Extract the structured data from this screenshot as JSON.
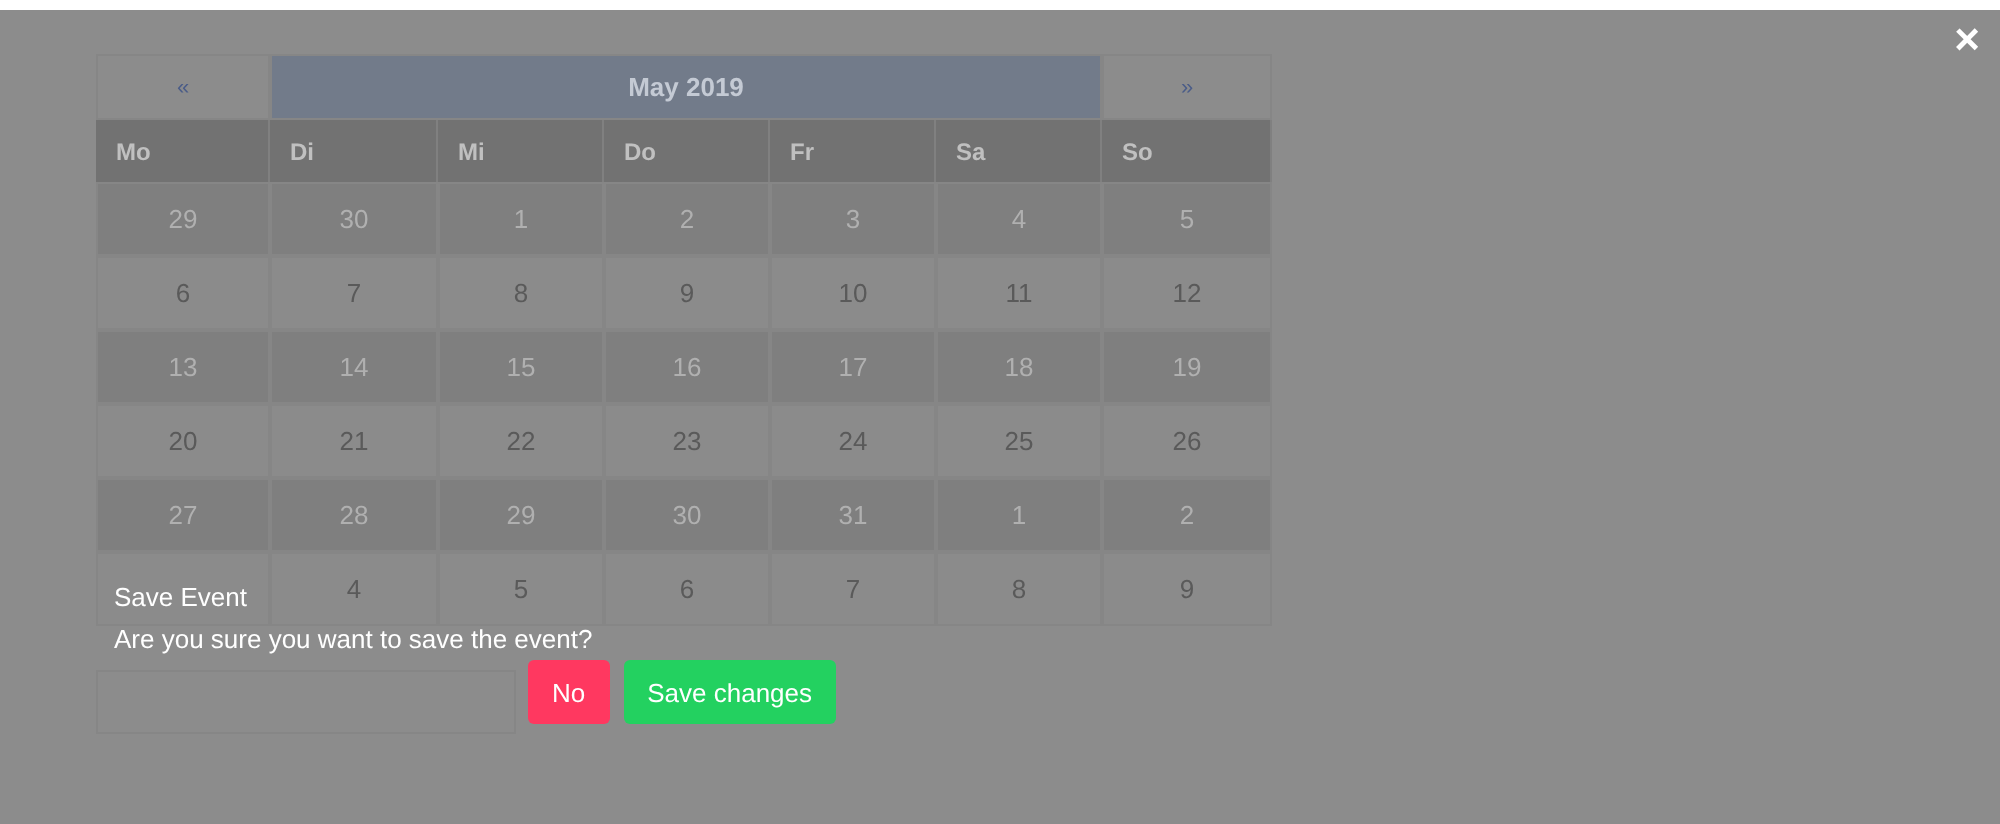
{
  "calendar": {
    "prev": "«",
    "title": "May 2019",
    "next": "»",
    "weekdays": [
      "Mo",
      "Di",
      "Mi",
      "Do",
      "Fr",
      "Sa",
      "So"
    ],
    "weeks": [
      [
        "29",
        "30",
        "1",
        "2",
        "3",
        "4",
        "5"
      ],
      [
        "6",
        "7",
        "8",
        "9",
        "10",
        "11",
        "12"
      ],
      [
        "13",
        "14",
        "15",
        "16",
        "17",
        "18",
        "19"
      ],
      [
        "20",
        "21",
        "22",
        "23",
        "24",
        "25",
        "26"
      ],
      [
        "27",
        "28",
        "29",
        "30",
        "31",
        "1",
        "2"
      ],
      [
        "4",
        "5",
        "6",
        "7",
        "8",
        "9"
      ]
    ]
  },
  "dialog": {
    "title": "Save Event",
    "message": "Are you sure you want to save the event?",
    "buttons": [
      {
        "label": "No",
        "kind": "danger"
      },
      {
        "label": "Save changes",
        "kind": "success"
      }
    ],
    "close": "×"
  }
}
